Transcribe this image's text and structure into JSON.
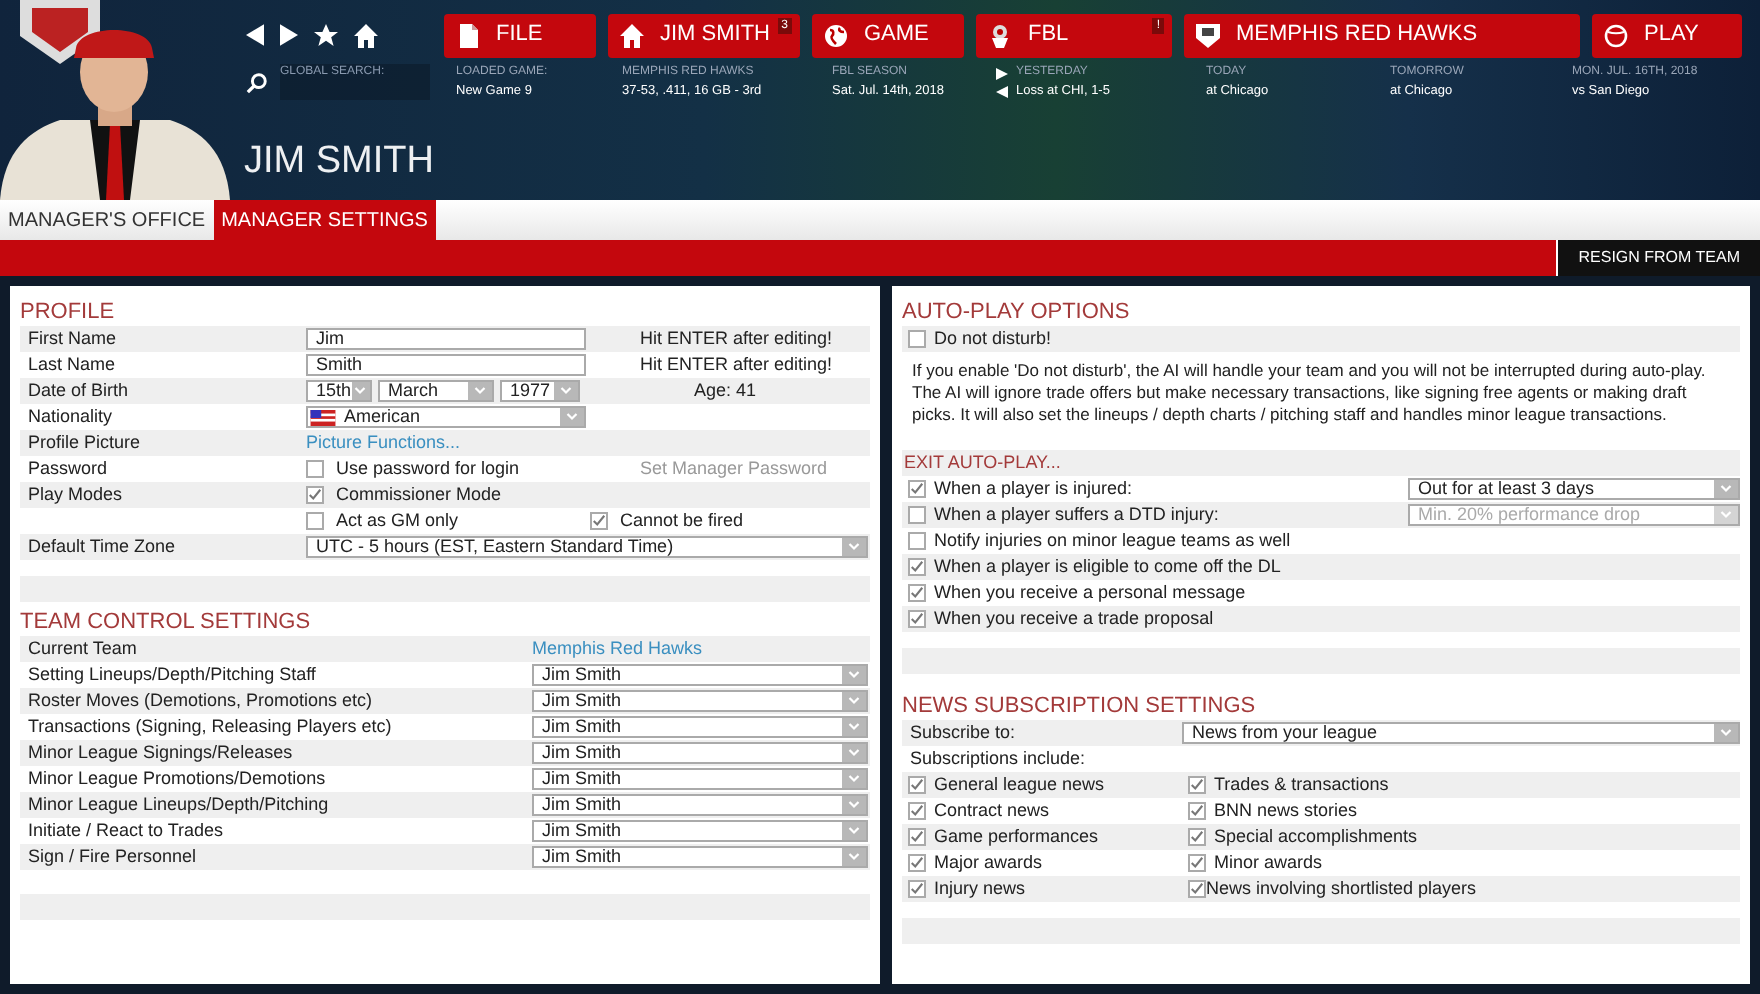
{
  "header": {
    "menu": [
      {
        "label": "FILE",
        "kind": "file"
      },
      {
        "label": "JIM SMITH",
        "kind": "home",
        "badge": "3"
      },
      {
        "label": "GAME",
        "kind": "globe"
      },
      {
        "label": "FBL",
        "kind": "league",
        "badge": "!"
      },
      {
        "label": "MEMPHIS RED HAWKS",
        "kind": "shield"
      },
      {
        "label": "PLAY",
        "kind": "ball"
      }
    ],
    "search": {
      "label": "GLOBAL SEARCH:"
    },
    "info": [
      {
        "label": "LOADED GAME:",
        "value": "New Game 9"
      },
      {
        "label": "MEMPHIS RED HAWKS",
        "value": "37-53, .411, 16 GB - 3rd"
      },
      {
        "label": "FBL SEASON",
        "value": "Sat. Jul. 14th, 2018"
      },
      {
        "label": "YESTERDAY",
        "value": "Loss at CHI, 1-5",
        "kind": "arrows"
      },
      {
        "label": "TODAY",
        "value": "at Chicago"
      },
      {
        "label": "TOMORROW",
        "value": "at Chicago"
      },
      {
        "label": "MON. JUL. 16TH, 2018",
        "value": "vs San Diego"
      }
    ],
    "title": "JIM SMITH"
  },
  "tabs": [
    {
      "label": "MANAGER'S OFFICE",
      "selected": false
    },
    {
      "label": "MANAGER SETTINGS",
      "selected": true
    }
  ],
  "resign_button": "RESIGN FROM TEAM",
  "profile": {
    "title": "PROFILE",
    "rows": [
      {
        "kind": "input",
        "label": "First Name",
        "value": "Jim",
        "note": "Hit ENTER after editing!"
      },
      {
        "kind": "input",
        "label": "Last Name",
        "value": "Smith",
        "note": "Hit ENTER after editing!"
      },
      {
        "kind": "date",
        "label": "Date of Birth",
        "day": "15th",
        "month": "March",
        "year": "1977",
        "note": "Age: 41"
      },
      {
        "kind": "flag_select",
        "label": "Nationality",
        "value": "American"
      },
      {
        "kind": "link",
        "label": "Profile Picture",
        "value": "Picture Functions..."
      },
      {
        "kind": "checks",
        "label": "Password",
        "checks": [
          {
            "label": "Use password for login",
            "checked": false
          }
        ],
        "note": "Set Manager Password"
      },
      {
        "kind": "checks",
        "label": "Play Modes",
        "checks": [
          {
            "label": "Commissioner Mode",
            "checked": true
          }
        ]
      },
      {
        "kind": "checks",
        "checks": [
          {
            "label": "Act as GM only",
            "checked": false
          },
          {
            "label": "Cannot be fired",
            "checked": true
          }
        ]
      },
      {
        "kind": "wide_select",
        "label": "Default Time Zone",
        "value": "UTC - 5 hours (EST, Eastern Standard Time)"
      }
    ]
  },
  "team_control": {
    "title": "TEAM CONTROL SETTINGS",
    "current_team": {
      "label": "Current Team",
      "value": "Memphis Red Hawks"
    },
    "rows": [
      {
        "label": "Setting Lineups/Depth/Pitching Staff",
        "value": "Jim Smith"
      },
      {
        "label": "Roster Moves (Demotions, Promotions etc)",
        "value": "Jim Smith"
      },
      {
        "label": "Transactions (Signing, Releasing Players etc)",
        "value": "Jim Smith"
      },
      {
        "label": "Minor League Signings/Releases",
        "value": "Jim Smith"
      },
      {
        "label": "Minor League Promotions/Demotions",
        "value": "Jim Smith"
      },
      {
        "label": "Minor League Lineups/Depth/Pitching",
        "value": "Jim Smith"
      },
      {
        "label": "Initiate / React to Trades",
        "value": "Jim Smith"
      },
      {
        "label": "Sign / Fire Personnel",
        "value": "Jim Smith"
      }
    ]
  },
  "autoplay": {
    "title": "AUTO-PLAY OPTIONS",
    "dnd": {
      "label": "Do not disturb!",
      "checked": false
    },
    "description": "If you enable 'Do not disturb', the AI will handle your team and you will not be interrupted during auto-play. The AI will ignore trade offers but make necessary transactions, like signing free agents or making draft picks. It will also set the lineups / depth charts / pitching staff and handles minor league transactions.",
    "exit_title": "EXIT AUTO-PLAY...",
    "rows": [
      {
        "label": "When a player is injured:",
        "checked": true,
        "select": {
          "value": "Out for at least 3 days",
          "disabled": false
        }
      },
      {
        "label": "When a player suffers a DTD injury:",
        "checked": false,
        "select": {
          "value": "Min. 20% performance drop",
          "disabled": true
        }
      },
      {
        "label": "Notify injuries on minor league teams as well",
        "checked": false
      },
      {
        "label": "When a player is eligible to come off the DL",
        "checked": true
      },
      {
        "label": "When you receive a personal message",
        "checked": true
      },
      {
        "label": "When you receive a trade proposal",
        "checked": true
      }
    ]
  },
  "news": {
    "title": "NEWS SUBSCRIPTION SETTINGS",
    "subscribe": {
      "label": "Subscribe to:",
      "value": "News from your league"
    },
    "include_label": "Subscriptions include:",
    "items": [
      {
        "label": "General league news",
        "checked": true
      },
      {
        "label": "Trades & transactions",
        "checked": true
      },
      {
        "label": "Contract news",
        "checked": true
      },
      {
        "label": "BNN news stories",
        "checked": true
      },
      {
        "label": "Game performances",
        "checked": true
      },
      {
        "label": "Special accomplishments",
        "checked": true
      },
      {
        "label": "Major awards",
        "checked": true
      },
      {
        "label": "Minor awards",
        "checked": true
      },
      {
        "label": "Injury news",
        "checked": true
      },
      {
        "label": "News involving shortlisted players",
        "checked": true
      }
    ]
  }
}
